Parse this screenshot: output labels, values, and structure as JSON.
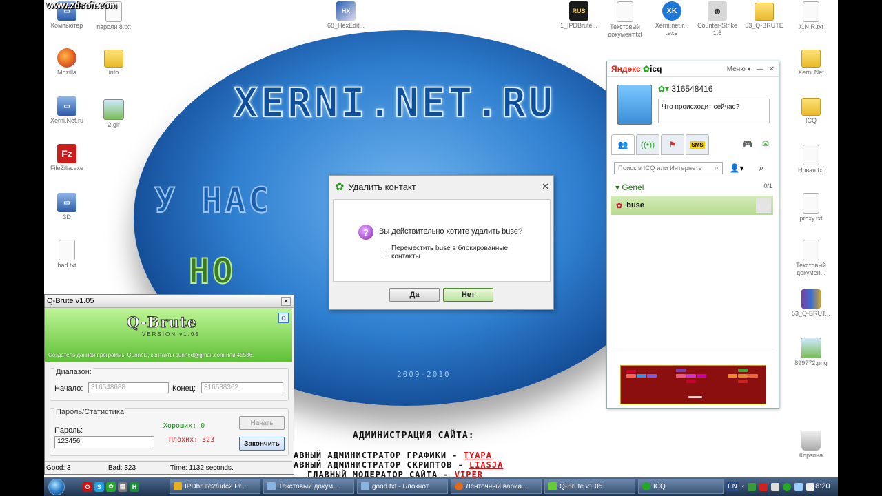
{
  "watermark": "www.zdsoft.com",
  "wallpaper": {
    "title": "XERNI.NET.RU",
    "line2": "У НАС",
    "line3": "НО",
    "year": "2009-2010",
    "admin_heading": "АДМИНИСТРАЦИЯ САЙТА:",
    "rows": [
      {
        "role": "АВНЫЙ АДМИНИСТРАТОР ГРАФИКИ - ",
        "name": "TYAPA"
      },
      {
        "role": "АВНЫЙ АДМИНИСТРАТОР СКРИПТОВ - ",
        "name": "LIASJA"
      },
      {
        "role": "ГЛАВНЫЙ МОДЕРАТОР САЙТА - ",
        "name": "VIPER"
      }
    ]
  },
  "desktop_icons_left": [
    {
      "label": "Компьютер",
      "icon": "computer-icon"
    },
    {
      "label": "пароли 8.txt",
      "icon": "text-file-icon"
    },
    {
      "label": "Mozilla",
      "icon": "firefox-icon"
    },
    {
      "label": "info",
      "icon": "folder-icon"
    },
    {
      "label": "Xerni.Net.ru",
      "icon": "computer-icon"
    },
    {
      "label": "2.gif",
      "icon": "image-icon"
    },
    {
      "label": "FileZilla.exe",
      "icon": "filezilla-icon"
    },
    {
      "label": "3D",
      "icon": "computer-icon"
    },
    {
      "label": "bad.txt",
      "icon": "text-file-icon"
    }
  ],
  "desktop_icons_top": [
    {
      "label": "68_HexEdit...",
      "icon": "hex-editor-icon"
    },
    {
      "label": "1_IPDBrute...",
      "icon": "ipdbrute-icon"
    },
    {
      "label": "Текстовый документ.txt",
      "icon": "text-file-icon"
    },
    {
      "label": "Xerni.net.r... .exe",
      "icon": "xerni-icon"
    },
    {
      "label": "Counter-Strike 1.6",
      "icon": "counter-strike-icon"
    },
    {
      "label": "53_Q-BRUTE",
      "icon": "folder-icon"
    },
    {
      "label": "X.N.R.txt",
      "icon": "text-file-icon"
    }
  ],
  "desktop_icons_right": [
    {
      "label": "Xerni.Net",
      "icon": "folder-icon"
    },
    {
      "label": "ICQ",
      "icon": "folder-icon"
    },
    {
      "label": "Новая.txt",
      "icon": "text-file-icon"
    },
    {
      "label": "proxy.txt",
      "icon": "text-file-icon"
    },
    {
      "label": "Текстовый докумен...",
      "icon": "text-file-icon"
    },
    {
      "label": "53_Q-BRUT...",
      "icon": "archive-icon"
    },
    {
      "label": "899772.png",
      "icon": "image-icon"
    },
    {
      "label": "Корзина",
      "icon": "recycle-bin-icon"
    }
  ],
  "icq": {
    "logo_ya": "Яндекс",
    "logo_icq": "icq",
    "menu": "Меню",
    "uin": "316548416",
    "status_text": "Что происходит сейчас?",
    "search_placeholder": "Поиск в ICQ или Интернете",
    "group_name": "Genel",
    "group_count": "0/1",
    "contact_name": "buse",
    "tab_sms": "SMS"
  },
  "dialog": {
    "title": "Удалить контакт",
    "question": "Вы действительно хотите удалить buse?",
    "checkbox_label": "Переместить buse в блокированные контакты",
    "yes": "Да",
    "no": "Нет"
  },
  "qbrute": {
    "title": "Q-Brute v1.05",
    "logo": "Q-Brute",
    "version": "VERSION v1.05",
    "credits": "Создатель данной программы QunneD, контакты qunned@gmail.com или 45536.",
    "range_label": "Диапазон:",
    "start_label": "Начало:",
    "start_value": "316548688",
    "end_label": "Конец:",
    "end_value": "316588362",
    "pass_group_label": "Пароль/Статистика",
    "password_label": "Пароль:",
    "password_value": "123456",
    "good_label": "Хороших: 0",
    "bad_label": "Плохих: 323",
    "start_button": "Начать",
    "stop_button": "Закончить",
    "status_good": "Good: 3",
    "status_bad": "Bad: 323",
    "status_time": "Time: 1132 seconds."
  },
  "taskbar": {
    "buttons": [
      {
        "label": "IPDbrute2/udc2 Pr..."
      },
      {
        "label": "Текстовый докум..."
      },
      {
        "label": "good.txt - Блокнот"
      },
      {
        "label": "Ленточный вариа..."
      },
      {
        "label": "Q-Brute v1.05"
      },
      {
        "label": "ICQ"
      }
    ],
    "lang": "EN",
    "clock": "18:20"
  }
}
